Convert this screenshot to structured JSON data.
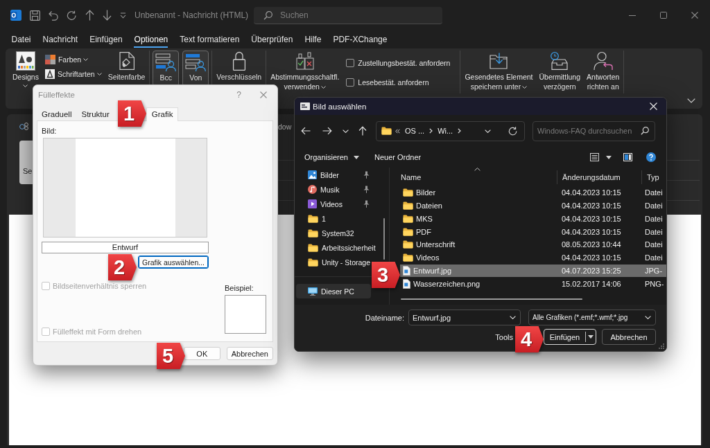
{
  "outlook": {
    "title": "Unbenannt - Nachricht (HTML)",
    "search": {
      "placeholder": "Suchen"
    },
    "menu": [
      {
        "label": "Datei",
        "selected": false
      },
      {
        "label": "Nachricht",
        "selected": false
      },
      {
        "label": "Einfügen",
        "selected": false
      },
      {
        "label": "Optionen",
        "selected": true
      },
      {
        "label": "Text formatieren",
        "selected": false
      },
      {
        "label": "Überprüfen",
        "selected": false
      },
      {
        "label": "Hilfe",
        "selected": false
      },
      {
        "label": "PDF-XChange",
        "selected": false
      }
    ],
    "ribbon": {
      "groups": [
        {
          "items": [
            {
              "kind": "large",
              "label": "Designs",
              "dropdown": true
            },
            {
              "kind": "stack",
              "entries": [
                {
                  "label": "Farben",
                  "dropdown": true
                },
                {
                  "label": "Schriftarten",
                  "dropdown": true
                }
              ]
            },
            {
              "kind": "large",
              "label": "Seitenfarbe",
              "dropdown": false
            }
          ]
        },
        {
          "items": [
            {
              "kind": "toggle",
              "label": "Bcc",
              "on": true
            },
            {
              "kind": "toggle",
              "label": "Von",
              "on": true
            }
          ]
        },
        {
          "items": [
            {
              "kind": "large",
              "label": "Verschlüsseln",
              "dropdown": false
            }
          ]
        },
        {
          "items": [
            {
              "kind": "large",
              "label": "Abstimmungsschaltfl.\nverwenden",
              "dropdown": true
            },
            {
              "kind": "checks",
              "entries": [
                {
                  "label": "Zustellungsbestät. anfordern",
                  "checked": false
                },
                {
                  "label": "Lesebestät. anfordern",
                  "checked": false
                }
              ]
            }
          ]
        },
        {
          "items": [
            {
              "kind": "large",
              "label": "Gesendetes Element\nspeichern unter",
              "dropdown": true
            },
            {
              "kind": "large",
              "label": "Übermittlung\nverzögern",
              "dropdown": false
            },
            {
              "kind": "large",
              "label": "Antworten\nrichten an",
              "dropdown": false
            }
          ]
        }
      ]
    },
    "compose": {
      "header_text": "dow",
      "send_button": "Se"
    }
  },
  "fill_effects": {
    "title": "Fülleffekte",
    "help": "?",
    "tabs": [
      {
        "label": "Graduell",
        "selected": false
      },
      {
        "label": "Struktur",
        "selected": false
      },
      {
        "label": "Grafik",
        "selected": true
      }
    ],
    "picture_label": "Bild:",
    "picture_name": "Entwurf",
    "select_button": "Grafik auswählen...",
    "options": [
      {
        "label": "Bildseitenverhältnis sperren",
        "checked": false,
        "disabled": true
      },
      {
        "label": "Fülleffekt mit Form drehen",
        "checked": false,
        "disabled": true
      }
    ],
    "sample_label": "Beispiel:",
    "buttons": [
      "OK",
      "Abbrechen"
    ]
  },
  "file_dialog": {
    "title": "Bild auswählen",
    "breadcrumb": [
      "OS ...",
      "Wi..."
    ],
    "search": {
      "placeholder": "Windows-FAQ durchsuchen"
    },
    "toolbar": [
      {
        "label": "Organisieren",
        "dropdown": true
      },
      {
        "label": "Neuer Ordner",
        "dropdown": false
      }
    ],
    "nav": [
      {
        "items": [
          {
            "label": "Bilder",
            "kind": "pictures",
            "pinned": true,
            "selected": false
          },
          {
            "label": "Musik",
            "kind": "music",
            "pinned": true,
            "selected": false
          },
          {
            "label": "Videos",
            "kind": "videos",
            "pinned": true,
            "selected": false
          },
          {
            "label": "1",
            "kind": "folder",
            "pinned": false,
            "selected": false
          },
          {
            "label": "System32",
            "kind": "folder",
            "pinned": false,
            "selected": false
          },
          {
            "label": "Arbeitssicherheit",
            "kind": "folder",
            "pinned": false,
            "selected": false
          },
          {
            "label": "Unity - Storage",
            "kind": "folder",
            "pinned": false,
            "selected": false
          }
        ]
      },
      {
        "items": [
          {
            "label": "Dieser PC",
            "kind": "pc",
            "pinned": false,
            "selected": true
          }
        ]
      }
    ],
    "columns": [
      "Name",
      "Änderungsdatum",
      "Typ"
    ],
    "files": [
      {
        "name": "Bilder",
        "modified": "04.04.2023 10:15",
        "type": "Datei",
        "kind": "folder",
        "selected": false
      },
      {
        "name": "Dateien",
        "modified": "04.04.2023 10:15",
        "type": "Datei",
        "kind": "folder",
        "selected": false
      },
      {
        "name": "MKS",
        "modified": "04.04.2023 10:15",
        "type": "Datei",
        "kind": "folder",
        "selected": false
      },
      {
        "name": "PDF",
        "modified": "04.04.2023 10:15",
        "type": "Datei",
        "kind": "folder",
        "selected": false
      },
      {
        "name": "Unterschrift",
        "modified": "08.05.2023 10:44",
        "type": "Datei",
        "kind": "folder",
        "selected": false
      },
      {
        "name": "Videos",
        "modified": "04.04.2023 10:15",
        "type": "Datei",
        "kind": "folder",
        "selected": false
      },
      {
        "name": "Entwurf.jpg",
        "modified": "04.07.2023 15:25",
        "type": "JPG-",
        "kind": "image",
        "selected": true
      },
      {
        "name": "Wasserzeichen.png",
        "modified": "15.02.2017 14:06",
        "type": "PNG-",
        "kind": "image",
        "selected": false
      }
    ],
    "filename_label": "Dateiname:",
    "filename": "Entwurf.jpg",
    "filter": "Alle Grafiken (*.emf;*.wmf;*.jpg",
    "tools": "Tools",
    "buttons": [
      {
        "label": "Einfügen",
        "split": true
      },
      {
        "label": "Abbrechen",
        "split": false
      }
    ]
  },
  "callouts": [
    "1",
    "2",
    "3",
    "4",
    "5"
  ]
}
